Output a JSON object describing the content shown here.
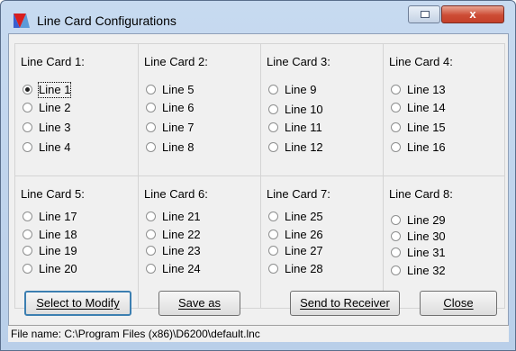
{
  "window": {
    "title": "Line Card Configurations",
    "close_glyph": "x"
  },
  "cards": [
    {
      "title": "Line Card 1:",
      "lines": [
        {
          "label": "Line 1",
          "checked": true
        },
        {
          "label": "Line 2"
        },
        {
          "label": "Line 3"
        },
        {
          "label": "Line 4"
        }
      ]
    },
    {
      "title": "Line Card 2:",
      "lines": [
        {
          "label": "Line 5"
        },
        {
          "label": "Line 6"
        },
        {
          "label": "Line 7"
        },
        {
          "label": "Line 8"
        }
      ]
    },
    {
      "title": "Line Card 3:",
      "lines": [
        {
          "label": "Line 9"
        },
        {
          "label": "Line 10"
        },
        {
          "label": "Line 11"
        },
        {
          "label": "Line 12"
        }
      ]
    },
    {
      "title": "Line Card 4:",
      "lines": [
        {
          "label": "Line 13"
        },
        {
          "label": "Line 14"
        },
        {
          "label": "Line 15"
        },
        {
          "label": "Line 16"
        }
      ]
    },
    {
      "title": "Line Card 5:",
      "lines": [
        {
          "label": "Line 17"
        },
        {
          "label": "Line 18"
        },
        {
          "label": "Line 19"
        },
        {
          "label": "Line 20"
        }
      ]
    },
    {
      "title": "Line Card 6:",
      "lines": [
        {
          "label": "Line 21"
        },
        {
          "label": "Line 22"
        },
        {
          "label": "Line 23"
        },
        {
          "label": "Line 24"
        }
      ]
    },
    {
      "title": "Line Card 7:",
      "lines": [
        {
          "label": "Line 25"
        },
        {
          "label": "Line 26"
        },
        {
          "label": "Line 27"
        },
        {
          "label": "Line 28"
        }
      ]
    },
    {
      "title": "Line Card 8:",
      "lines": [
        {
          "label": "Line 29"
        },
        {
          "label": "Line 30"
        },
        {
          "label": "Line 31"
        },
        {
          "label": "Line 32"
        }
      ]
    }
  ],
  "buttons": {
    "select": "Select to Modify",
    "save_as": "Save as",
    "send": "Send to Receiver",
    "close": "Close"
  },
  "status": {
    "file_name": "File name: C:\\Program Files (x86)\\D6200\\default.lnc"
  },
  "colors": {
    "titlebar": "#c7daf0",
    "close_button": "#cd4c35",
    "client": "#f0f0f0"
  }
}
